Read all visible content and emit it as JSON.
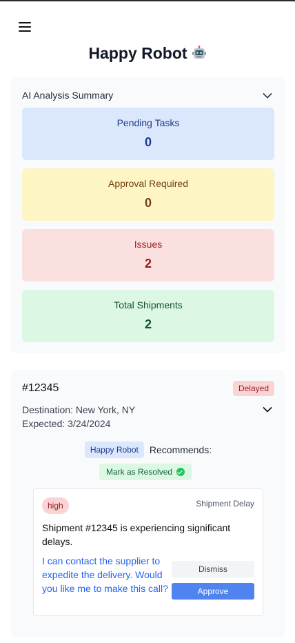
{
  "header": {
    "title": "Happy Robot"
  },
  "summary": {
    "heading": "AI Analysis Summary",
    "stats": [
      {
        "label": "Pending Tasks",
        "value": "0",
        "color": "#dbe7fc"
      },
      {
        "label": "Approval Required",
        "value": "0",
        "color": "#fdf6c4"
      },
      {
        "label": "Issues",
        "value": "2",
        "color": "#fbe0e0"
      },
      {
        "label": "Total Shipments",
        "value": "2",
        "color": "#dcf7e4"
      }
    ]
  },
  "shipment": {
    "id": "#12345",
    "status": "Delayed",
    "destination": "Destination: New York, NY",
    "expected": "Expected: 3/24/2024",
    "recommender": "Happy Robot",
    "recommends_label": "Recommends:",
    "recommended_action": "Mark as Resolved",
    "issue": {
      "severity": "high",
      "type": "Shipment Delay",
      "description": "Shipment #12345 is experiencing significant delays.",
      "suggestion": "I can contact the supplier to expedite the delivery. Would you like me to make this call?",
      "dismiss_label": "Dismiss",
      "approve_label": "Approve"
    }
  },
  "colors": {
    "accent": "#4f84f0",
    "link": "#2563eb",
    "danger_bg": "#fad4d4",
    "danger_text": "#991b1b"
  },
  "icons": {
    "menu": "hamburger-menu-icon",
    "title_emoji": "robot-face-icon",
    "collapse": "chevron-down-icon",
    "resolved": "check-circle-icon"
  }
}
